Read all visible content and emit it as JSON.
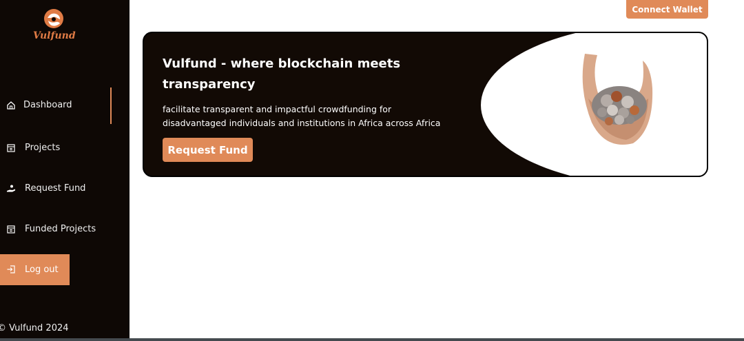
{
  "app": {
    "name": "Vulfund"
  },
  "sidebar": {
    "items": [
      {
        "label": "Dashboard",
        "icon": "home-icon",
        "active": true
      },
      {
        "label": "Projects",
        "icon": "projects-icon"
      },
      {
        "label": "Request Fund",
        "icon": "hand-coin-icon"
      },
      {
        "label": "Funded Projects",
        "icon": "projects-icon"
      }
    ],
    "logout_label": "Log out",
    "logout_icon": "logout-icon"
  },
  "footer": {
    "text": "© Vulfund 2024"
  },
  "header": {
    "connect_wallet_label": "Connect Wallet"
  },
  "hero": {
    "title": "Vulfund - where blockchain meets transparency",
    "description": "facilitate transparent and impactful crowdfunding for disadvantaged individuals and institutions in Africa across Africa",
    "cta_label": "Request Fund"
  },
  "colors": {
    "sidebar_bg": "#0e0805",
    "accent": "#e08a58",
    "hero_bg": "#120a05",
    "logo_text": "#e07b45"
  }
}
